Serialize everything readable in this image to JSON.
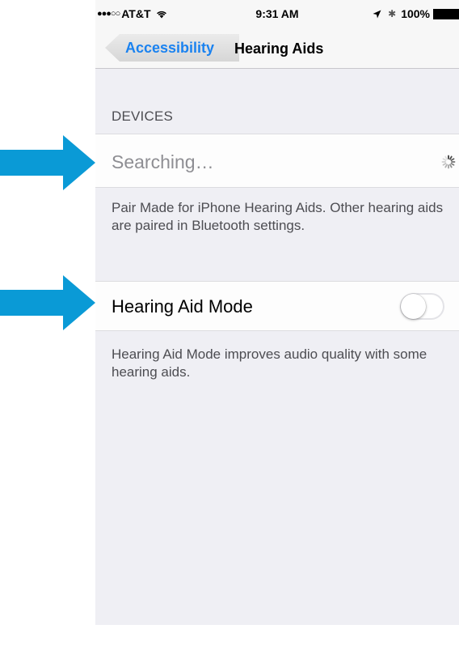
{
  "colors": {
    "accent": "#1a82f0",
    "arrow": "#0a9ad6",
    "background": "#efeff4",
    "cell": "#fdfdfd"
  },
  "status_bar": {
    "signal": "●●●○○",
    "carrier": "AT&T",
    "time": "9:31 AM",
    "bluetooth": "✱",
    "battery": "100%",
    "icons": [
      "wifi-icon",
      "location-icon",
      "bluetooth-icon",
      "battery-icon"
    ]
  },
  "nav": {
    "back_label": "Accessibility",
    "title": "Hearing Aids"
  },
  "devices": {
    "header": "DEVICES",
    "searching_label": "Searching…",
    "spinner_icon": "activity-spinner-icon",
    "footer": "Pair Made for iPhone Hearing Aids. Other hearing aids are paired in Bluetooth settings."
  },
  "hearing_aid_mode": {
    "label": "Hearing Aid Mode",
    "enabled": false,
    "footer": "Hearing Aid Mode improves audio quality with some hearing aids."
  },
  "annotations": {
    "icon": "arrow-right-icon",
    "count": 2
  }
}
